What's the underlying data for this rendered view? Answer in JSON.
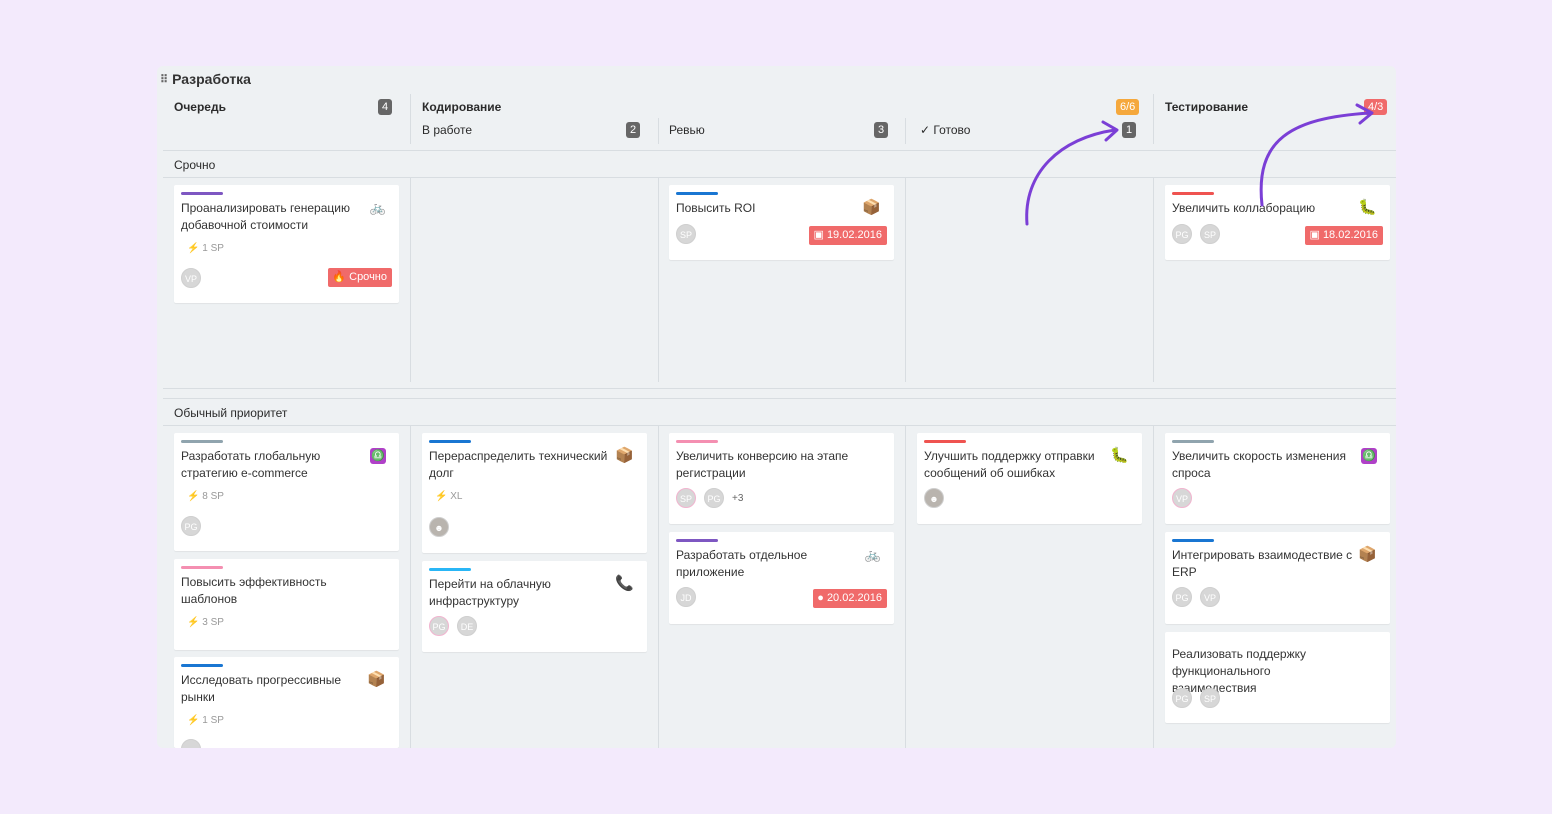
{
  "board": {
    "title": "Разработка",
    "drag_icon": "grip-dots-icon"
  },
  "columns": {
    "queue": {
      "label": "Очередь",
      "count": "4"
    },
    "coding": {
      "label": "Кодирование",
      "limit": "6/6"
    },
    "in_progress": {
      "label": "В работе",
      "count": "2"
    },
    "review": {
      "label": "Ревью",
      "count": "3"
    },
    "done": {
      "label": "✓ Готово",
      "count": "1"
    },
    "testing": {
      "label": "Тестирование",
      "limit": "4/3"
    }
  },
  "lanes": {
    "urgent": "Срочно",
    "normal": "Обычный приоритет"
  },
  "cards": {
    "c1": {
      "title": "Проанализировать генерацию добавочной стоимости",
      "sp": "1 SP",
      "avatar": "VP",
      "tag": "Срочно",
      "icon": "bicycle-icon"
    },
    "c2": {
      "title": "Повысить ROI",
      "avatar": "SP",
      "date": "19.02.2016",
      "icon": "package-icon"
    },
    "c3": {
      "title": "Увеличить коллаборацию",
      "avatars": [
        "PG",
        "SP"
      ],
      "date": "18.02.2016",
      "icon": "caterpillar-icon"
    },
    "c4": {
      "title": "Разработать глобальную стратегию e-commerce",
      "sp": "8 SP",
      "avatar": "PG",
      "icon": "libra-icon"
    },
    "c5": {
      "title": "Повысить эффективность шаблонов",
      "sp": "3 SP"
    },
    "c6": {
      "title": "Исследовать прогрессивные рынки",
      "sp": "1 SP",
      "icon": "package-icon"
    },
    "c7": {
      "title": "Перераспределить технический долг",
      "sp": "XL",
      "icon": "package-icon"
    },
    "c8": {
      "title": "Перейти на облачную инфраструктуру",
      "avatars": [
        "PG",
        "DE"
      ],
      "icon": "phone-icon"
    },
    "c9": {
      "title": "Увеличить конверсию на этапе регистрации",
      "avatars": [
        "SP",
        "PG"
      ],
      "more": "+3"
    },
    "c10": {
      "title": "Разработать отдельное приложение",
      "avatar": "JD",
      "date": "20.02.2016",
      "icon": "bicycle-icon"
    },
    "c11": {
      "title": "Улучшить поддержку отправки сообщений об ошибках",
      "icon": "caterpillar-icon"
    },
    "c12": {
      "title": "Увеличить скорость изменения спроса",
      "avatar": "VP",
      "icon": "libra-icon"
    },
    "c13": {
      "title": "Интегрировать взаимодествие с ERP",
      "avatars": [
        "PG",
        "VP"
      ],
      "icon": "package-icon"
    },
    "c14": {
      "title": "Реализовать поддержку функционального взаимодествия",
      "avatars": [
        "PG",
        "SP"
      ]
    }
  },
  "colors": {
    "background": "#f3eafc",
    "board": "#eef1f3",
    "arrow": "#7b3fd6",
    "badge_red": "#f06a6a",
    "badge_orange": "#f5a83c",
    "purple": "#7e57c2",
    "blue": "#1976d2",
    "red": "#ef5350",
    "gray": "#90a4ae",
    "pink": "#f48fb1",
    "lightblue": "#29b6f6"
  }
}
